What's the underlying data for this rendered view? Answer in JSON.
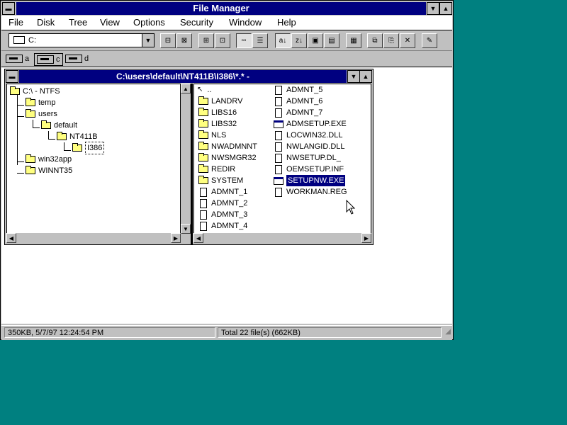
{
  "app": {
    "title": "File Manager",
    "menu": [
      "File",
      "Disk",
      "Tree",
      "View",
      "Options",
      "Security",
      "Window",
      "Help"
    ]
  },
  "toolbar": {
    "drive_select": "C:",
    "drives": [
      "a",
      "c",
      "d"
    ]
  },
  "child_window": {
    "title": "C:\\users\\default\\NT411B\\I386\\*.* -"
  },
  "tree": [
    {
      "label": "C:\\ - NTFS",
      "depth": 0,
      "open": true
    },
    {
      "label": "temp",
      "depth": 1
    },
    {
      "label": "users",
      "depth": 1
    },
    {
      "label": "default",
      "depth": 2
    },
    {
      "label": "NT411B",
      "depth": 3
    },
    {
      "label": "I386",
      "depth": 4,
      "selected": true
    },
    {
      "label": "win32app",
      "depth": 1
    },
    {
      "label": "WINNT35",
      "depth": 1
    }
  ],
  "files": {
    "col1": [
      {
        "label": "..",
        "type": "up"
      },
      {
        "label": "LANDRV",
        "type": "folder"
      },
      {
        "label": "LIBS16",
        "type": "folder"
      },
      {
        "label": "LIBS32",
        "type": "folder"
      },
      {
        "label": "NLS",
        "type": "folder"
      },
      {
        "label": "NWADMNNT",
        "type": "folder"
      },
      {
        "label": "NWSMGR32",
        "type": "folder"
      },
      {
        "label": "REDIR",
        "type": "folder"
      },
      {
        "label": "SYSTEM",
        "type": "folder"
      },
      {
        "label": "ADMNT_1",
        "type": "doc"
      },
      {
        "label": "ADMNT_2",
        "type": "doc"
      },
      {
        "label": "ADMNT_3",
        "type": "doc"
      },
      {
        "label": "ADMNT_4",
        "type": "doc"
      }
    ],
    "col2": [
      {
        "label": "ADMNT_5",
        "type": "doc"
      },
      {
        "label": "ADMNT_6",
        "type": "doc"
      },
      {
        "label": "ADMNT_7",
        "type": "doc"
      },
      {
        "label": "ADMSETUP.EXE",
        "type": "exe"
      },
      {
        "label": "LOCWIN32.DLL",
        "type": "doc"
      },
      {
        "label": "NWLANGID.DLL",
        "type": "doc"
      },
      {
        "label": "NWSETUP.DL_",
        "type": "doc"
      },
      {
        "label": "OEMSETUP.INF",
        "type": "doc"
      },
      {
        "label": "SETUPNW.EXE",
        "type": "exe",
        "selected": true
      },
      {
        "label": "WORKMAN.REG",
        "type": "doc"
      }
    ]
  },
  "status": {
    "left": "350KB, 5/7/97 12:24:54 PM",
    "right": "Total 22 file(s) (662KB)"
  }
}
